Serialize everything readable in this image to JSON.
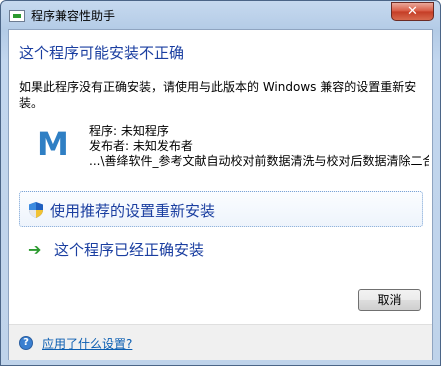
{
  "window": {
    "title": "程序兼容性助手",
    "close_glyph": "✕"
  },
  "content": {
    "heading": "这个程序可能安装不正确",
    "message": "如果此程序没有正确安装，请使用与此版本的 Windows 兼容的设置重新安装。",
    "program_icon_letter": "M",
    "program_line": "程序: 未知程序",
    "publisher_line": "发布者: 未知发布者",
    "path_line": "...\\善绛软件_参考文献自动校对前数据清洗与校对后数据清除二合一"
  },
  "options": [
    {
      "label": "使用推荐的设置重新安装",
      "icon": "shield-icon"
    },
    {
      "label": "这个程序已经正确安装",
      "icon": "green-arrow-icon",
      "icon_glyph": "➔"
    }
  ],
  "buttons": {
    "cancel": "取消"
  },
  "footer": {
    "help_icon_glyph": "?",
    "link": "应用了什么设置?"
  }
}
